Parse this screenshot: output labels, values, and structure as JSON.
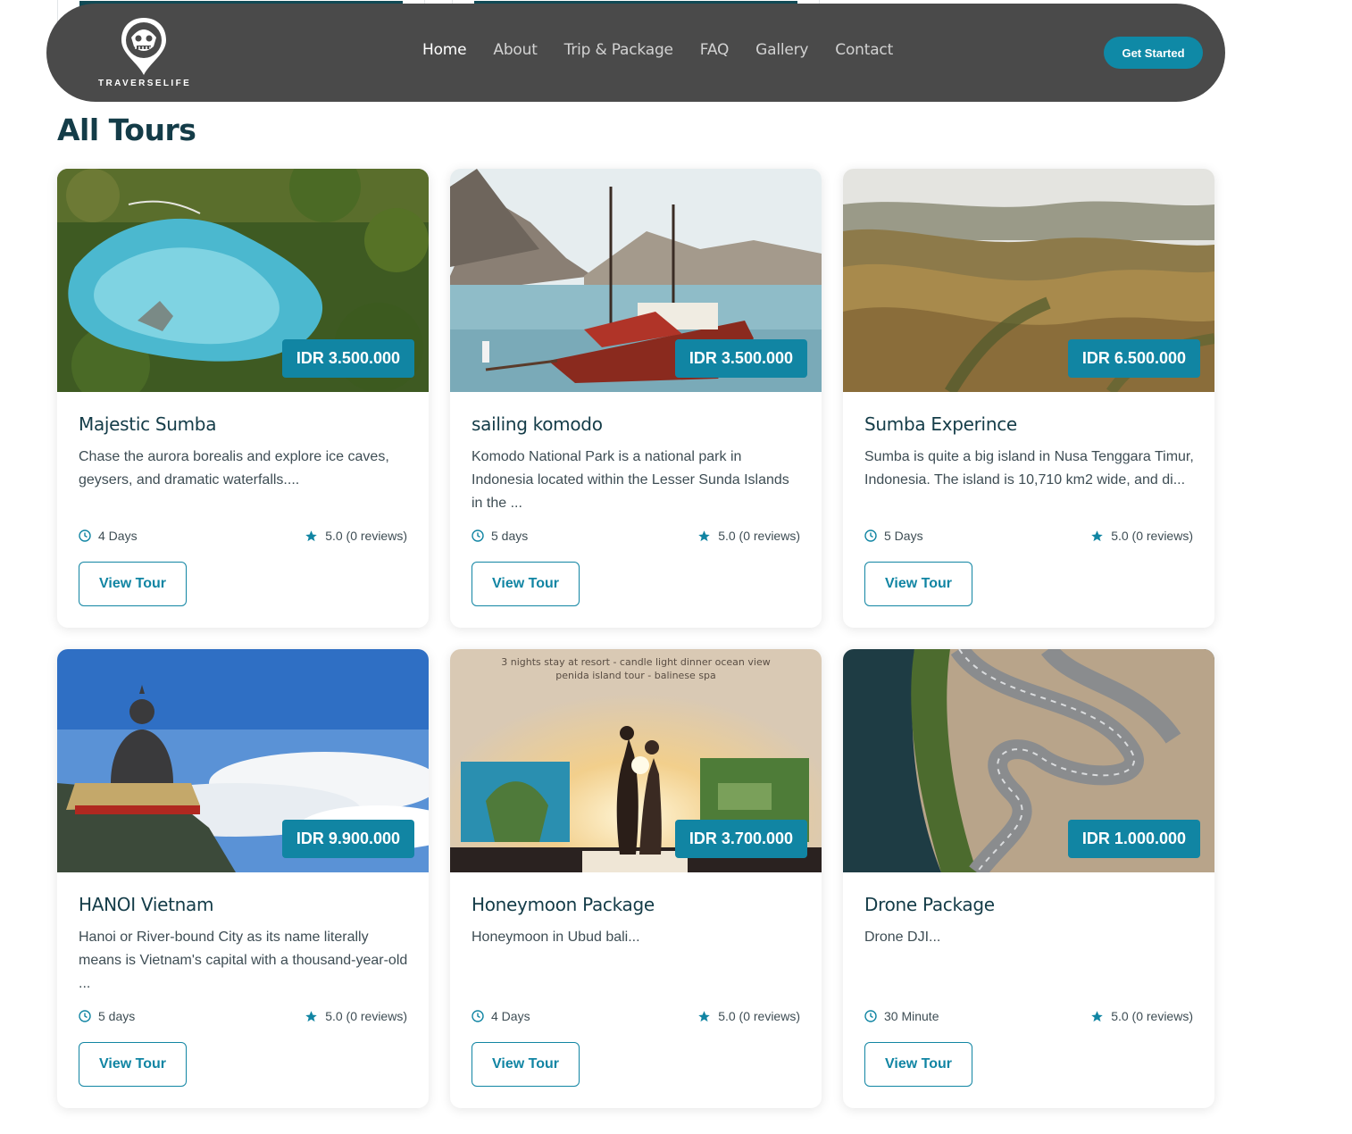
{
  "brand": {
    "name": "TRAVERSELIFE"
  },
  "nav": {
    "links": [
      "Home",
      "About",
      "Trip & Package",
      "FAQ",
      "Gallery",
      "Contact"
    ],
    "active": "Home",
    "cta_label": "Get Started"
  },
  "section": {
    "title": "All Tours"
  },
  "carousel": {
    "dot_count": 4,
    "active_dot": 1
  },
  "colors": {
    "accent": "#1185a3",
    "navbar": "#4a4a4a",
    "heading": "#143c48"
  },
  "tours": [
    {
      "title": "Majestic Sumba",
      "description": "Chase the aurora borealis and explore ice caves, geysers, and dramatic waterfalls....",
      "price": "IDR 3.500.000",
      "duration": "4 Days",
      "rating": "5.0 (0 reviews)",
      "button": "View Tour",
      "image": "lagoon-aerial"
    },
    {
      "title": "sailing komodo",
      "description": "Komodo National Park is a national park in Indonesia located within the Lesser Sunda Islands in the ...",
      "price": "IDR 3.500.000",
      "duration": "5 days",
      "rating": "5.0 (0 reviews)",
      "button": "View Tour",
      "image": "phinisi-boat"
    },
    {
      "title": "Sumba Experince",
      "description": "Sumba is quite a big island in Nusa Tenggara Timur, Indonesia. The island is 10,710 km2 wide, and di...",
      "price": "IDR 6.500.000",
      "duration": "5 Days",
      "rating": "5.0 (0 reviews)",
      "button": "View Tour",
      "image": "rolling-hills"
    },
    {
      "title": "HANOI Vietnam",
      "description": "Hanoi or River-bound City as its name literally means is Vietnam's capital with a thousand-year-old ...",
      "price": "IDR 9.900.000",
      "duration": "5 days",
      "rating": "5.0 (0 reviews)",
      "button": "View Tour",
      "image": "buddha-statue"
    },
    {
      "title": "Honeymoon Package",
      "description": "Honeymoon in Ubud bali...",
      "price": "IDR 3.700.000",
      "duration": "4 Days",
      "rating": "5.0 (0 reviews)",
      "button": "View Tour",
      "image": "honeymoon-collage",
      "image_caption_1": "3 nights stay at resort - candle light dinner ocean view",
      "image_caption_2": "penida island tour - balinese spa"
    },
    {
      "title": "Drone Package",
      "description": "Drone DJI...",
      "price": "IDR 1.000.000",
      "duration": "30 Minute",
      "rating": "5.0 (0 reviews)",
      "button": "View Tour",
      "image": "winding-road"
    }
  ]
}
